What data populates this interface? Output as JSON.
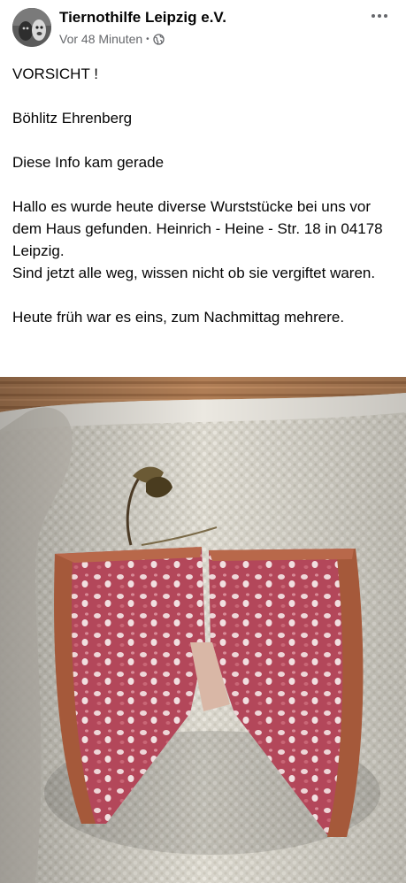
{
  "post": {
    "page_name": "Tiernothilfe Leipzig e.V.",
    "timestamp": "Vor 48 Minuten",
    "audience_icon": "globe-icon",
    "avatar_icon": "avatar",
    "more_icon": "more-options-icon",
    "paragraphs": [
      "VORSICHT !",
      "Böhlitz Ehrenberg",
      "Diese Info kam gerade",
      "Hallo es wurde heute diverse Wurststücke bei uns vor dem Haus gefunden. Heinrich - Heine - Str. 18 in 04178 Leipzig.\nSind jetzt alle weg, wissen nicht ob sie vergiftet waren.",
      "Heute früh war es eins, zum Nachmittag mehrere."
    ]
  },
  "colors": {
    "text": "#050505",
    "secondary_text": "#65676b",
    "background": "#ffffff"
  }
}
